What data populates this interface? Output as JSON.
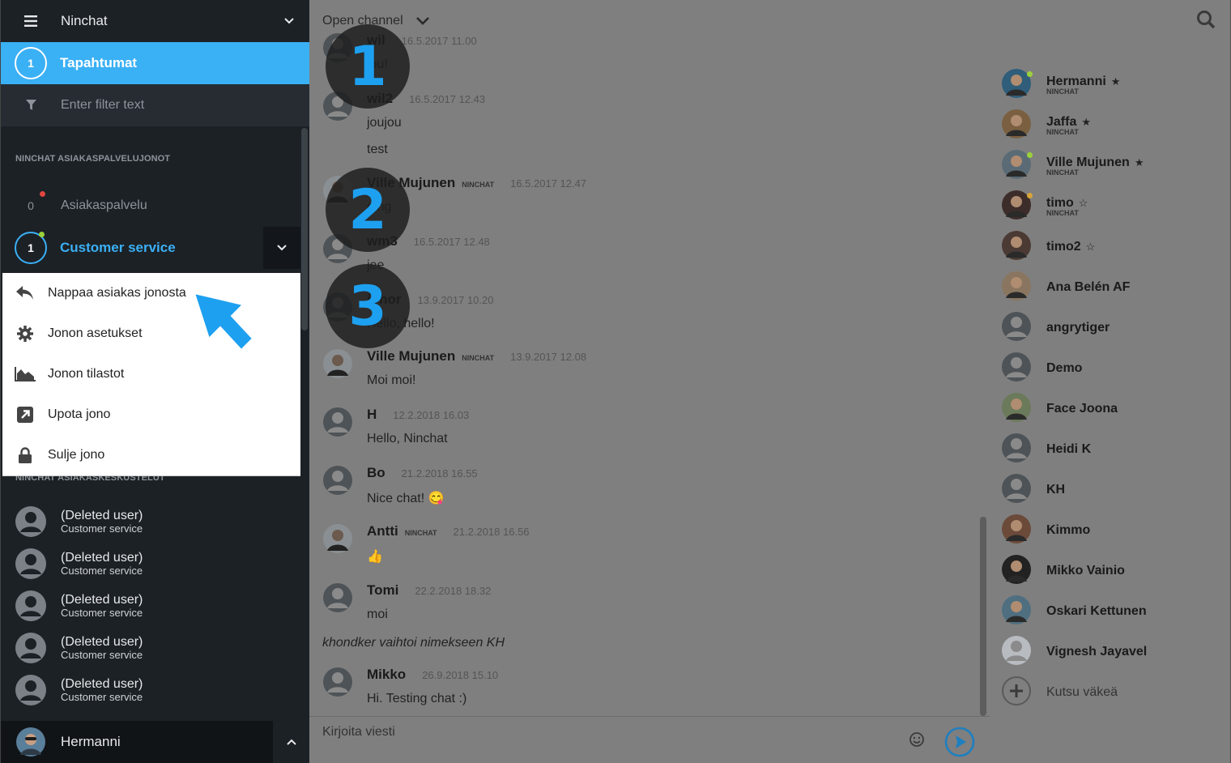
{
  "sidebar": {
    "header_title": "Ninchat",
    "active": {
      "badge": "1",
      "label": "Tapahtumat"
    },
    "filter_placeholder": "Enter filter text",
    "section_queues": "NINCHAT ASIAKASPALVELUJONOT",
    "queues": [
      {
        "count": "0",
        "label": "Asiakaspalvelu",
        "dot_color": "#e0463f"
      },
      {
        "count": "1",
        "label": "Customer service",
        "dot_color": "#9bd13a"
      }
    ],
    "menu": [
      {
        "icon": "reply-icon",
        "label": "Nappaa asiakas jonosta"
      },
      {
        "icon": "gear-icon",
        "label": "Jonon asetukset"
      },
      {
        "icon": "area-chart-icon",
        "label": "Jonon tilastot"
      },
      {
        "icon": "external-link-icon",
        "label": "Upota jono"
      },
      {
        "icon": "lock-icon",
        "label": "Sulje jono"
      }
    ],
    "section_conversations": "NINCHAT ASIAKASKESKUSTELUT",
    "conversations": [
      {
        "name": "(Deleted user)",
        "queue": "Customer service"
      },
      {
        "name": "(Deleted user)",
        "queue": "Customer service"
      },
      {
        "name": "(Deleted user)",
        "queue": "Customer service"
      },
      {
        "name": "(Deleted user)",
        "queue": "Customer service"
      },
      {
        "name": "(Deleted user)",
        "queue": "Customer service"
      }
    ],
    "footer_user": "Hermanni"
  },
  "channel": {
    "title": "Open channel",
    "messages": [
      {
        "name": "wil",
        "tag": "",
        "time": "16.5.2017 11.00",
        "lines": [
          "jou!"
        ]
      },
      {
        "name": "wil2",
        "tag": "",
        "time": "16.5.2017 12.43",
        "lines": [
          "joujou",
          "test"
        ]
      },
      {
        "name": "Ville Mujunen",
        "tag": "NINCHAT",
        "time": "16.5.2017 12.47",
        "lines": [
          "ding"
        ]
      },
      {
        "name": "wm3",
        "tag": "",
        "time": "16.5.2017 12.48",
        "lines": [
          "jee"
        ]
      },
      {
        "name": "johor",
        "tag": "",
        "time": "13.9.2017 10.20",
        "lines": [
          "Hello, hello!"
        ]
      },
      {
        "name": "Ville Mujunen",
        "tag": "NINCHAT",
        "time": "13.9.2017 12.08",
        "lines": [
          "Moi moi!"
        ]
      },
      {
        "name": "H",
        "tag": "",
        "time": "12.2.2018 16.03",
        "lines": [
          "Hello, Ninchat"
        ]
      },
      {
        "name": "Bo",
        "tag": "",
        "time": "21.2.2018 16.55",
        "lines": [
          "Nice chat! 😋"
        ]
      },
      {
        "name": "Antti",
        "tag": "NINCHAT",
        "time": "21.2.2018 16.56",
        "lines": [
          "👍"
        ]
      },
      {
        "name": "Tomi",
        "tag": "",
        "time": "22.2.2018 18.32",
        "lines": [
          "moi"
        ]
      },
      {
        "name": "Mikko",
        "tag": "",
        "time": "26.9.2018 15.10",
        "lines": [
          "Hi. Testing chat :)"
        ]
      }
    ],
    "system_message": "khondker vaihtoi nimekseen KH",
    "composer_placeholder": "Kirjoita viesti"
  },
  "members": [
    {
      "name": "Hermanni",
      "sub": "NINCHAT",
      "star": "★"
    },
    {
      "name": "Jaffa",
      "sub": "NINCHAT",
      "star": "★"
    },
    {
      "name": "Ville Mujunen",
      "sub": "NINCHAT",
      "star": "★"
    },
    {
      "name": "timo",
      "sub": "NINCHAT",
      "star": "☆"
    },
    {
      "name": "timo2",
      "sub": "",
      "star": "☆"
    },
    {
      "name": "Ana Belén AF",
      "sub": "",
      "star": ""
    },
    {
      "name": "angrytiger",
      "sub": "",
      "star": ""
    },
    {
      "name": "Demo",
      "sub": "",
      "star": ""
    },
    {
      "name": "Face Joona",
      "sub": "",
      "star": ""
    },
    {
      "name": "Heidi K",
      "sub": "",
      "star": ""
    },
    {
      "name": "KH",
      "sub": "",
      "star": ""
    },
    {
      "name": "Kimmo",
      "sub": "",
      "star": ""
    },
    {
      "name": "Mikko Vainio",
      "sub": "",
      "star": ""
    },
    {
      "name": "Oskari Kettunen",
      "sub": "",
      "star": ""
    },
    {
      "name": "Vignesh Jayavel",
      "sub": "",
      "star": ""
    }
  ],
  "invite_label": "Kutsu väkeä",
  "steps": [
    "1",
    "2",
    "3"
  ],
  "colors": {
    "accent": "#3ab0f5",
    "sidebar_bg": "#1c2126",
    "overlay": "#7f7f7f"
  }
}
